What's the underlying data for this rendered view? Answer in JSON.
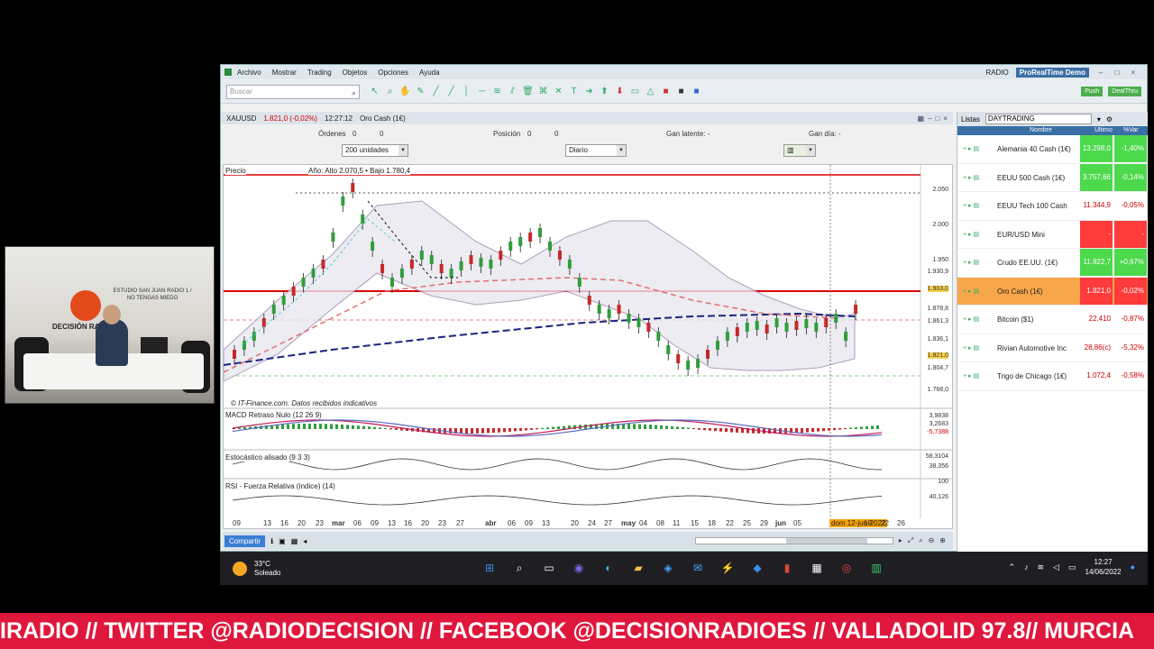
{
  "window": {
    "menu": [
      "Archivo",
      "Mostrar",
      "Trading",
      "Objetos",
      "Opciones",
      "Ayuda"
    ],
    "right_items": [
      "RADIO"
    ],
    "brand": "ProRealTime Demo",
    "search_placeholder": "Buscar",
    "toolbar_right": [
      "Push",
      "DealThru"
    ]
  },
  "instrument": {
    "symbol": "XAUUSD",
    "price": "1.821,0 (-0,02%)",
    "time": "12:27:12",
    "name": "Oro Cash (1€)"
  },
  "orders_bar": {
    "ordenes_label": "Órdenes",
    "ordenes_value": "0",
    "ordenes_frac": "0",
    "posicion_label": "Posición",
    "posicion_value": "0",
    "posicion_frac": "0",
    "gan_latente": "Gan latente: -",
    "gan_dia": "Gan día: -"
  },
  "selectors": {
    "units": "200 unidades",
    "period": "Diario"
  },
  "price_pane": {
    "label": "Precio",
    "range_text": "Año: Alto 2.070,5 • Bajo 1.780,4",
    "source": "© IT-Finance.com. Datos recibidos indicativos",
    "y_ticks": [
      "2.050",
      "2.000",
      "1.950",
      "1.930,9",
      "1.903,0",
      "1.878,8",
      "1.861,3",
      "1.836,1",
      "1.821,0",
      "1.804,7",
      "1.768,0"
    ]
  },
  "macd_pane": {
    "label": "MACD Retraso Nulo (12 26 9)",
    "y_ticks": [
      "3,9838",
      "3,2683",
      "-5,7388"
    ]
  },
  "stoch_pane": {
    "label": "Estocástico alisado (9 3 3)",
    "y_ticks": [
      "58,3104",
      "38,356"
    ]
  },
  "rsi_pane": {
    "label": "RSI - Fuerza Relativa (índice) (14)",
    "y_ticks": [
      "100",
      "40,126"
    ]
  },
  "x_axis": [
    "09",
    "13",
    "16",
    "20",
    "23",
    "mar",
    "06",
    "09",
    "13",
    "16",
    "20",
    "23",
    "27",
    "abr",
    "06",
    "09",
    "13",
    "20",
    "24",
    "27",
    "may",
    "04",
    "08",
    "11",
    "15",
    "18",
    "22",
    "25",
    "29",
    "jun",
    "05",
    "dom 12-jun-2022",
    "19",
    "22",
    "26"
  ],
  "chart_bottom": {
    "share": "Compartir"
  },
  "watchlist": {
    "title": "Listas",
    "list": "DAYTRADING",
    "columns": [
      "Nombre",
      "Último",
      "%Var"
    ],
    "rows": [
      {
        "name": "Alemania 40 Cash (1€)",
        "last": "13.298,0",
        "pct": "-1,40%"
      },
      {
        "name": "EEUU 500 Cash (1€)",
        "last": "3.757,66",
        "pct": "-0,14%"
      },
      {
        "name": "EEUU Tech 100 Cash",
        "last": "11.344,9",
        "pct": "-0,05%"
      },
      {
        "name": "EUR/USD Mini",
        "last": "-",
        "pct": "-"
      },
      {
        "name": "Crudo EE.UU. (1€)",
        "last": "11.922,7",
        "pct": "+0,67%"
      },
      {
        "name": "Oro Cash (1€)",
        "last": "1.821,0",
        "pct": "-0,02%"
      },
      {
        "name": "Bitcoin ($1)",
        "last": "22.410",
        "pct": "-0,87%"
      },
      {
        "name": "Rivian Automotive Inc",
        "last": "28,86(c)",
        "pct": "-5,32%"
      },
      {
        "name": "Trigo de Chicago (1€)",
        "last": "1.072,4",
        "pct": "-0,58%"
      }
    ]
  },
  "colors": {
    "green": "#4cd94c",
    "red": "#ff3b3b",
    "highlight": "#f7a64a",
    "ticker_bg": "#e0173c"
  },
  "taskbar": {
    "temp": "33°C",
    "weather": "Soleado",
    "time": "12:27",
    "date": "14/06/2022"
  },
  "webcam": {
    "studio_text": "ESTUDIO SAN JUAN RADIO 1 / NO TENGAS MIEDO",
    "brand": "DECISIÓN RADIO"
  },
  "ticker": "IRADIO // TWITTER @RADIODECISION // FACEBOOK @DECISIONRADIOES // VALLADOLID 97.8// MURCIA"
}
